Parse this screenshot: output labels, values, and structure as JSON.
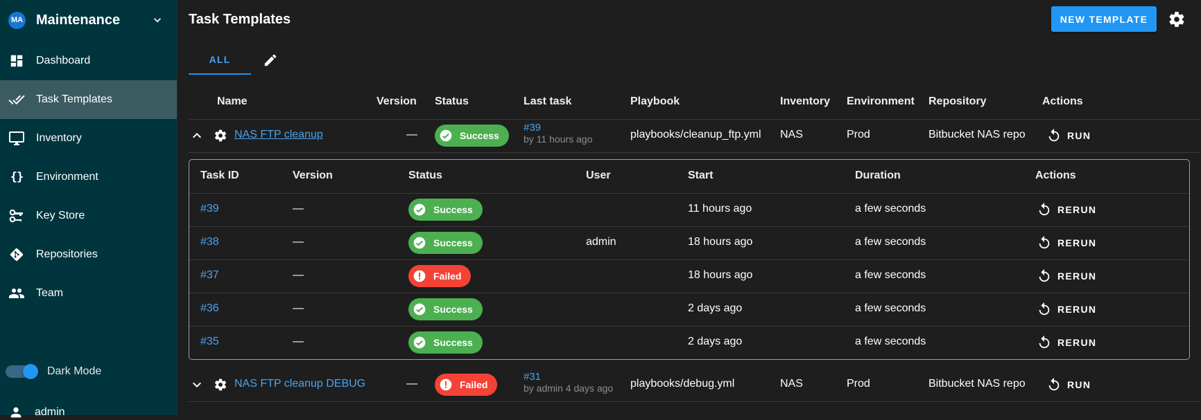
{
  "sidebar": {
    "avatar": "MA",
    "project_name": "Maintenance",
    "items": [
      {
        "label": "Dashboard",
        "icon": "dashboard-icon"
      },
      {
        "label": "Task Templates",
        "icon": "done-all-icon",
        "active": true
      },
      {
        "label": "Inventory",
        "icon": "monitor-icon"
      },
      {
        "label": "Environment",
        "icon": "braces-icon",
        "glyph": "{}"
      },
      {
        "label": "Key Store",
        "icon": "key-chain-icon"
      },
      {
        "label": "Repositories",
        "icon": "git-icon"
      },
      {
        "label": "Team",
        "icon": "team-icon"
      }
    ],
    "dark_mode_label": "Dark Mode",
    "dark_mode_on": true,
    "user_label": "admin"
  },
  "header": {
    "title": "Task Templates",
    "new_template_label": "NEW TEMPLATE"
  },
  "tabs": {
    "all_label": "ALL"
  },
  "templates_table": {
    "columns": [
      "Name",
      "Version",
      "Status",
      "Last task",
      "Playbook",
      "Inventory",
      "Environment",
      "Repository",
      "Actions"
    ],
    "rows": [
      {
        "name": "NAS FTP cleanup",
        "version": "—",
        "status": "Success",
        "last_task_id": "#39",
        "last_task_sub": "by 11 hours ago",
        "playbook": "playbooks/cleanup_ftp.yml",
        "inventory": "NAS",
        "environment": "Prod",
        "repository": "Bitbucket NAS repo",
        "action": "RUN",
        "expanded": true
      },
      {
        "name": "NAS FTP cleanup DEBUG",
        "version": "—",
        "status": "Failed",
        "last_task_id": "#31",
        "last_task_sub": "by admin 4 days ago",
        "playbook": "playbooks/debug.yml",
        "inventory": "NAS",
        "environment": "Prod",
        "repository": "Bitbucket NAS repo",
        "action": "RUN",
        "expanded": false
      }
    ]
  },
  "tasks_table": {
    "columns": [
      "Task ID",
      "Version",
      "Status",
      "User",
      "Start",
      "Duration",
      "Actions"
    ],
    "rows": [
      {
        "id": "#39",
        "version": "—",
        "status": "Success",
        "user": "",
        "start": "11 hours ago",
        "duration": "a few seconds",
        "action": "RERUN"
      },
      {
        "id": "#38",
        "version": "—",
        "status": "Success",
        "user": "admin",
        "start": "18 hours ago",
        "duration": "a few seconds",
        "action": "RERUN"
      },
      {
        "id": "#37",
        "version": "—",
        "status": "Failed",
        "user": "",
        "start": "18 hours ago",
        "duration": "a few seconds",
        "action": "RERUN"
      },
      {
        "id": "#36",
        "version": "—",
        "status": "Success",
        "user": "",
        "start": "2 days ago",
        "duration": "a few seconds",
        "action": "RERUN"
      },
      {
        "id": "#35",
        "version": "—",
        "status": "Success",
        "user": "",
        "start": "2 days ago",
        "duration": "a few seconds",
        "action": "RERUN"
      }
    ]
  },
  "colors": {
    "sidebar_bg": "#00353e",
    "sidebar_active": "#3b5b61",
    "page_bg": "#1e1e1e",
    "accent": "#2196f3",
    "link": "#4aa3f0",
    "success": "#4caf50",
    "failed": "#f44336"
  }
}
